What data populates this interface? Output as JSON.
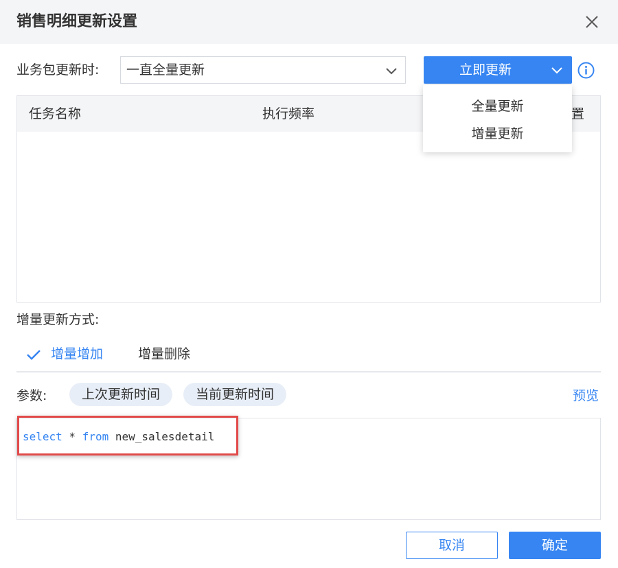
{
  "dialog": {
    "title": "销售明细更新设置",
    "close_icon": "close-icon"
  },
  "update_time": {
    "label": "业务包更新时:",
    "select_value": "一直全量更新",
    "update_now_label": "立即更新",
    "info_icon": "info-icon"
  },
  "dropdown": {
    "items": [
      "全量更新",
      "增量更新"
    ]
  },
  "task_table": {
    "columns": [
      "任务名称",
      "执行频率",
      "置"
    ],
    "rows": []
  },
  "incremental": {
    "label": "增量更新方式:",
    "tabs": [
      {
        "label": "增量增加",
        "active": true,
        "icon": "check-icon"
      },
      {
        "label": "增量删除",
        "active": false
      }
    ]
  },
  "params": {
    "label": "参数:",
    "chips": [
      "上次更新时间",
      "当前更新时间"
    ],
    "preview_label": "预览"
  },
  "sql_editor": {
    "tokens": [
      {
        "text": "select",
        "kind": "kw"
      },
      {
        "text": " * ",
        "kind": "plain"
      },
      {
        "text": "from",
        "kind": "kw"
      },
      {
        "text": " new_salesdetail",
        "kind": "plain"
      }
    ]
  },
  "footer": {
    "cancel_label": "取消",
    "ok_label": "确定"
  },
  "colors": {
    "primary": "#3685f2",
    "highlight": "#e24a4a",
    "header_bg": "#f4f5f7"
  }
}
